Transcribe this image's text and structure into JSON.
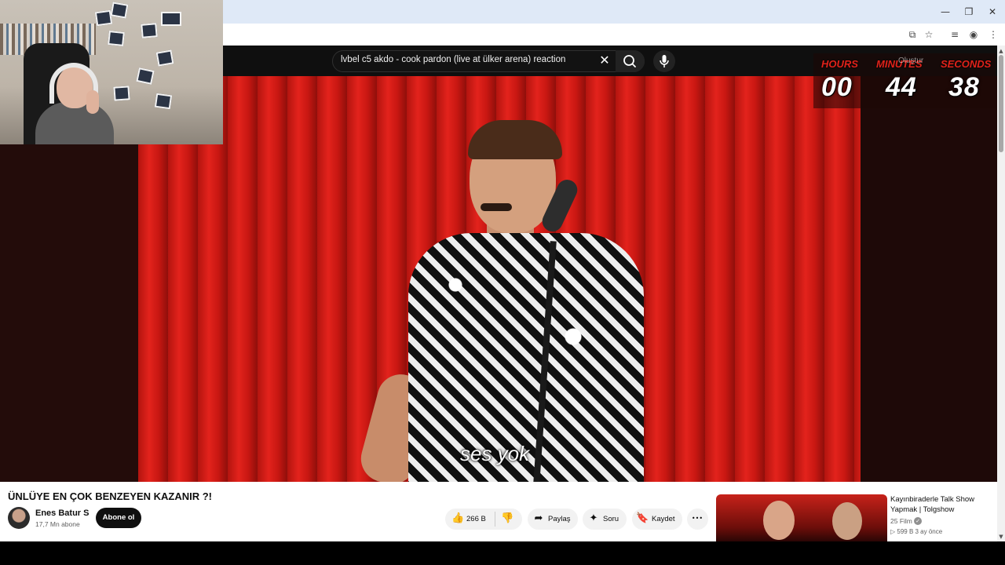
{
  "browser": {
    "minimize_icon": "minimize-icon",
    "restore_icon": "restore-icon",
    "close_icon": "close-icon",
    "minimize_glyph": "—",
    "restore_glyph": "❐",
    "close_glyph": "✕",
    "toolbar_icons": [
      "install-app-icon",
      "star-icon",
      "media-queue-icon",
      "profile-icon",
      "kebab-menu-icon"
    ],
    "glyph_install": "⧉",
    "glyph_star": "☆",
    "glyph_media": "≡",
    "glyph_profile": "◉",
    "glyph_kebab": "⋮"
  },
  "youtube": {
    "search": {
      "value": "lvbel c5 akdo - cook pardon (live at ülker arena) reaction",
      "clear_glyph": "✕",
      "search_glyph": "⌕",
      "mic_glyph": "🎙"
    },
    "header_right": {
      "create_label": "Oluştur"
    },
    "video": {
      "subtitle": "ses yok"
    },
    "timer": {
      "hours_label": "HOURS",
      "minutes_label": "MINUTES",
      "seconds_label": "SECONDS",
      "hours": "00",
      "minutes": "44",
      "seconds": "38",
      "label_color": "#e0221a"
    },
    "details": {
      "title": "ÜNLÜYE EN ÇOK BENZEYEN KAZANIR ?!",
      "channel": "Enes Batur S",
      "subscribers": "17,7 Mn abone",
      "subscribe_label": "Abone ol",
      "like_count": "266 B",
      "share_label": "Paylaş",
      "ask_label": "Soru",
      "save_label": "Kaydet",
      "like_glyph": "👍",
      "dislike_glyph": "👎",
      "share_glyph": "➦",
      "ask_glyph": "✦",
      "save_glyph": "🔖",
      "more_glyph": "•••"
    },
    "recommended": [
      {
        "title": "Kayınbiraderle Talk Show Yapmak | Tolgshow",
        "channel": "25 Film",
        "verified_glyph": "✓",
        "meta": "▷ 599 B   3 ay önce"
      }
    ]
  },
  "colors": {
    "brand_red": "#e3231c",
    "yt_dark": "#0f0f0f",
    "chrome_tab": "#dfe9f7"
  },
  "scroll": {
    "up_glyph": "▲",
    "down_glyph": "▼"
  }
}
